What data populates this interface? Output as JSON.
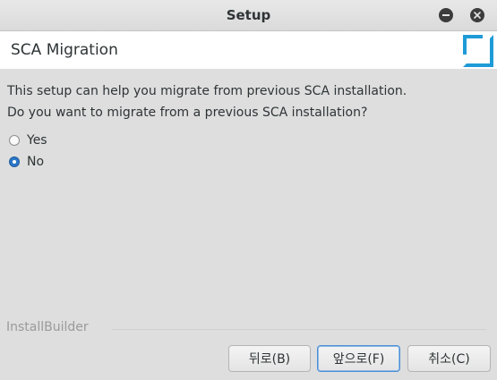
{
  "window": {
    "title": "Setup"
  },
  "header": {
    "title": "SCA Migration"
  },
  "body": {
    "line1": "This setup can help you migrate from previous SCA installation.",
    "line2": "Do you want to migrate from a previous SCA installation?"
  },
  "options": [
    {
      "label": "Yes",
      "selected": false
    },
    {
      "label": "No",
      "selected": true
    }
  ],
  "footer": {
    "brand": "InstallBuilder",
    "back_label": "뒤로(B)",
    "next_label": "앞으로(F)",
    "cancel_label": "취소(C)"
  },
  "colors": {
    "accent": "#1e9bd7",
    "radio_selected": "#2a76c6"
  }
}
